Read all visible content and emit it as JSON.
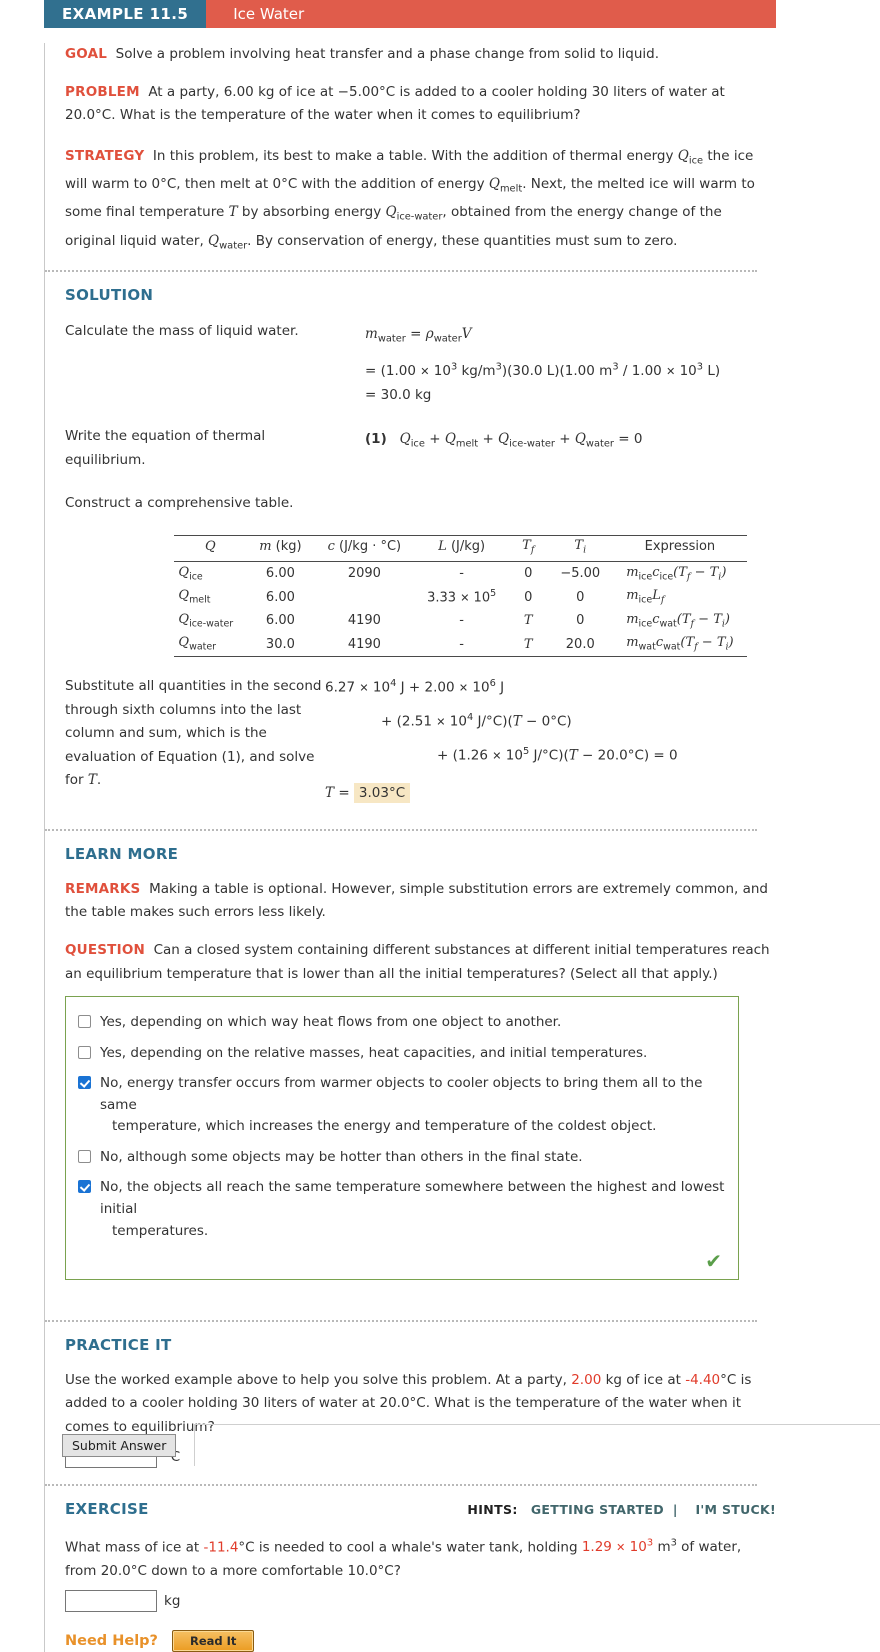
{
  "header": {
    "example_tab": "EXAMPLE 11.5",
    "title": "Ice Water",
    "tab_color": "#31708f",
    "title_color": "#e05c4b"
  },
  "goal": {
    "label": "GOAL",
    "text": "Solve a problem involving heat transfer and a phase change from solid to liquid."
  },
  "problem": {
    "label": "PROBLEM",
    "text": "At a party, 6.00 kg of ice at −5.00°C is added to a cooler holding 30 liters of water at 20.0°C. What is the temperature of the water when it comes to equilibrium?"
  },
  "strategy": {
    "label": "STRATEGY",
    "part1": "In this problem, its best to make a table. With the addition of thermal energy",
    "q1_sub": "ice",
    "part2": "the ice will warm to 0°C, then melt at 0°C with the addition of energy",
    "q2_sub": "melt",
    "part3": ". Next, the melted ice will warm to some final temperature",
    "tvar": "T",
    "part4": "by absorbing energy",
    "q3_sub": "ice-water",
    "part5": ", obtained from the energy change of the original liquid water,",
    "q4_sub": "water",
    "part6": ". By conservation of energy, these quantities must sum to zero."
  },
  "solution": {
    "heading": "SOLUTION",
    "step1": {
      "desc": "Calculate the mass of liquid water.",
      "line1_lhs_m": "m",
      "line1_lhs_sub": "water",
      "line1_rho": "ρ",
      "line1_rho_sub": "water",
      "line1_v": "V",
      "line2": "= (1.00 × 10³ kg/m³)(30.0 L)(1.00 m³ / 1.00 × 10³ L)",
      "line3": "= 30.0 kg"
    },
    "step2": {
      "desc_line1": "Write the equation of thermal",
      "desc_line2": "equilibrium.",
      "eqnum": "(1)",
      "terms": [
        "ice",
        "melt",
        "ice-water",
        "water"
      ],
      "rhs": "= 0"
    },
    "step3": {
      "desc": "Construct a comprehensive table."
    },
    "step4": {
      "desc": "Substitute all quantities in the second through sixth columns into the last column and sum, which is the evaluation of Equation (1), and solve for T.",
      "line1": "6.27 × 10⁴ J + 2.00 × 10⁶ J",
      "line2": "+ (2.51 × 10⁴ J/°C)(T − 0°C)",
      "line3": "+ (1.26 × 10⁵ J/°C)(T − 20.0°C) = 0",
      "result_label": "T =",
      "result_value": "3.03°C",
      "result_highlight": "#f7e7c4"
    }
  },
  "table_data": {
    "type": "table",
    "headers": [
      "Q",
      "m (kg)",
      "c (J/kg · °C)",
      "L (J/kg)",
      "T_f",
      "T_i",
      "Expression"
    ],
    "rows": [
      {
        "q": "ice",
        "m": "6.00",
        "c": "2090",
        "L": "-",
        "Tf": "0",
        "Ti": "−5.00",
        "expr": "m_ice c_ice (T_f − T_i)"
      },
      {
        "q": "melt",
        "m": "6.00",
        "c": "",
        "L": "3.33 × 10⁵",
        "Tf": "0",
        "Ti": "0",
        "expr": "m_ice L_f"
      },
      {
        "q": "ice-water",
        "m": "6.00",
        "c": "4190",
        "L": "-",
        "Tf": "T",
        "Ti": "0",
        "expr": "m_ice c_wat (T_f − T_i)"
      },
      {
        "q": "water",
        "m": "30.0",
        "c": "4190",
        "L": "-",
        "Tf": "T",
        "Ti": "20.0",
        "expr": "m_wat c_wat (T_f − T_i)"
      }
    ]
  },
  "learn_more": {
    "heading": "LEARN MORE",
    "remarks_label": "REMARKS",
    "remarks_text": "Making a table is optional. However, simple substitution errors are extremely common, and the table makes such errors less likely.",
    "question_label": "QUESTION",
    "question_text": "Can a closed system containing different substances at different initial temperatures reach an equilibrium temperature that is lower than all the initial temperatures? (Select all that apply.)",
    "choices": [
      {
        "checked": false,
        "text": "Yes, depending on which way heat flows from one object to another.",
        "cont": ""
      },
      {
        "checked": false,
        "text": "Yes, depending on the relative masses, heat capacities, and initial temperatures.",
        "cont": ""
      },
      {
        "checked": true,
        "text": "No, energy transfer occurs from warmer objects to cooler objects to bring them all to the same",
        "cont": "temperature, which increases the energy and temperature of the coldest object."
      },
      {
        "checked": false,
        "text": "No, although some objects may be hotter than others in the final state.",
        "cont": ""
      },
      {
        "checked": true,
        "text": "No, the objects all reach the same temperature somewhere between the highest and lowest initial",
        "cont": "temperatures."
      }
    ],
    "correct_mark": "✔",
    "correct_color": "#5a9e4a",
    "box_border": "#7aa24f"
  },
  "practice_it": {
    "heading": "PRACTICE IT",
    "text_a": "Use the worked example above to help you solve this problem. At a party,",
    "mass": "2.00",
    "text_b": "kg of ice at",
    "temp": "-4.40",
    "text_c": "°C is added to a cooler holding 30 liters of water at 20.0°C. What is the temperature of the water when it comes to equilibrium?",
    "input_value": "",
    "input_placeholder": "",
    "unit": "°C"
  },
  "exercise": {
    "heading": "EXERCISE",
    "hints_label": "HINTS:",
    "hint_getting_started": "GETTING STARTED",
    "hint_separator": "|",
    "hint_im_stuck": "I'M STUCK!",
    "text_a": "What mass of ice at",
    "temp": "-11.4",
    "text_b": "°C is needed to cool a whale's water tank, holding",
    "volume_mantissa": "1.29",
    "volume_exp": "3",
    "text_c": "m³ of water, from 20.0°C down to a more comfortable 10.0°C?",
    "input_value": "",
    "unit": "kg"
  },
  "need_help": {
    "label": "Need Help?",
    "button": "Read It",
    "label_color": "#e8912a"
  },
  "footer": {
    "submit_label": "Submit Answer"
  }
}
